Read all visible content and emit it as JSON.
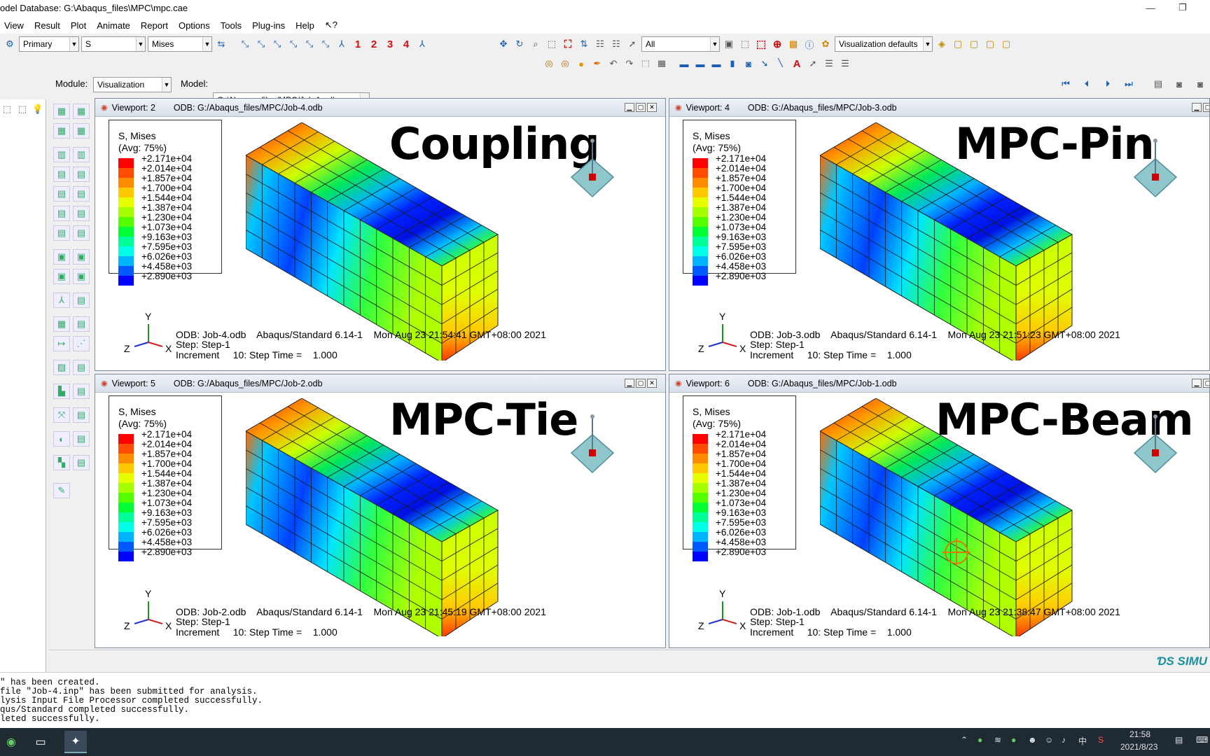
{
  "window": {
    "title": "odel Database: G:\\Abaqus_files\\MPC\\mpc.cae",
    "minimize": "—",
    "restore": "❐"
  },
  "menu": [
    "View",
    "Result",
    "Plot",
    "Animate",
    "Report",
    "Options",
    "Tools",
    "Plug-ins",
    "Help",
    "↖?"
  ],
  "toolbar": {
    "primary": "Primary",
    "variable": "S",
    "invariant": "Mises",
    "steps": [
      "1",
      "2",
      "3",
      "4"
    ],
    "selection_filter": "All",
    "visualization_defaults": "Visualization defaults"
  },
  "module_bar": {
    "module_label": "Module:",
    "module_value": "Visualization",
    "model_label": "Model:",
    "model_value": "G:/Abaqus_files/MPC/Job-1.odb"
  },
  "legend": {
    "title1": "S, Mises",
    "title2": "(Avg: 75%)",
    "values": [
      "+2.171e+04",
      "+2.014e+04",
      "+1.857e+04",
      "+1.700e+04",
      "+1.544e+04",
      "+1.387e+04",
      "+1.230e+04",
      "+1.073e+04",
      "+9.163e+03",
      "+7.595e+03",
      "+6.026e+03",
      "+4.458e+03",
      "+2.890e+03"
    ],
    "colors": [
      "#ff0000",
      "#ff4c00",
      "#ff8c00",
      "#ffc800",
      "#e6ff00",
      "#a6ff00",
      "#55ff00",
      "#00ff33",
      "#00ff99",
      "#00ffe6",
      "#00b3ff",
      "#0059ff",
      "#0000ff"
    ]
  },
  "viewports": [
    {
      "id": "Viewport: 2",
      "odb_path": "ODB: G:/Abaqus_files/MPC/Job-4.odb",
      "big_title": "Coupling",
      "info_line1": "ODB: Job-4.odb    Abaqus/Standard 6.14-1    Mon Aug 23 21:54:41 GMT+08:00 2021",
      "info_line2": "Step: Step-1",
      "info_line3": "Increment     10: Step Time =    1.000"
    },
    {
      "id": "Viewport: 4",
      "odb_path": "ODB: G:/Abaqus_files/MPC/Job-3.odb",
      "big_title": "MPC-Pin",
      "info_line1": "ODB: Job-3.odb    Abaqus/Standard 6.14-1    Mon Aug 23 21:51:23 GMT+08:00 2021",
      "info_line2": "Step: Step-1",
      "info_line3": "Increment     10: Step Time =    1.000"
    },
    {
      "id": "Viewport: 5",
      "odb_path": "ODB: G:/Abaqus_files/MPC/Job-2.odb",
      "big_title": "MPC-Tie",
      "info_line1": "ODB: Job-2.odb    Abaqus/Standard 6.14-1    Mon Aug 23 21:45:19 GMT+08:00 2021",
      "info_line2": "Step: Step-1",
      "info_line3": "Increment     10: Step Time =    1.000"
    },
    {
      "id": "Viewport: 6",
      "odb_path": "ODB: G:/Abaqus_files/MPC/Job-1.odb",
      "big_title": "MPC-Beam",
      "info_line1": "ODB: Job-1.odb    Abaqus/Standard 6.14-1    Mon Aug 23 21:38:47 GMT+08:00 2021",
      "info_line2": "Step: Step-1",
      "info_line3": "Increment     10: Step Time =    1.000"
    }
  ],
  "triad_labels": {
    "x": "X",
    "y": "Y",
    "z": "Z"
  },
  "brand": "SIMU",
  "messages": [
    "\" has been created.",
    "file \"Job-4.inp\" has been submitted for analysis.",
    "lysis Input File Processor completed successfully.",
    "qus/Standard completed successfully.",
    "leted successfully."
  ],
  "taskbar": {
    "time": "21:58",
    "date": "2021/8/23",
    "ime_label": "中"
  }
}
